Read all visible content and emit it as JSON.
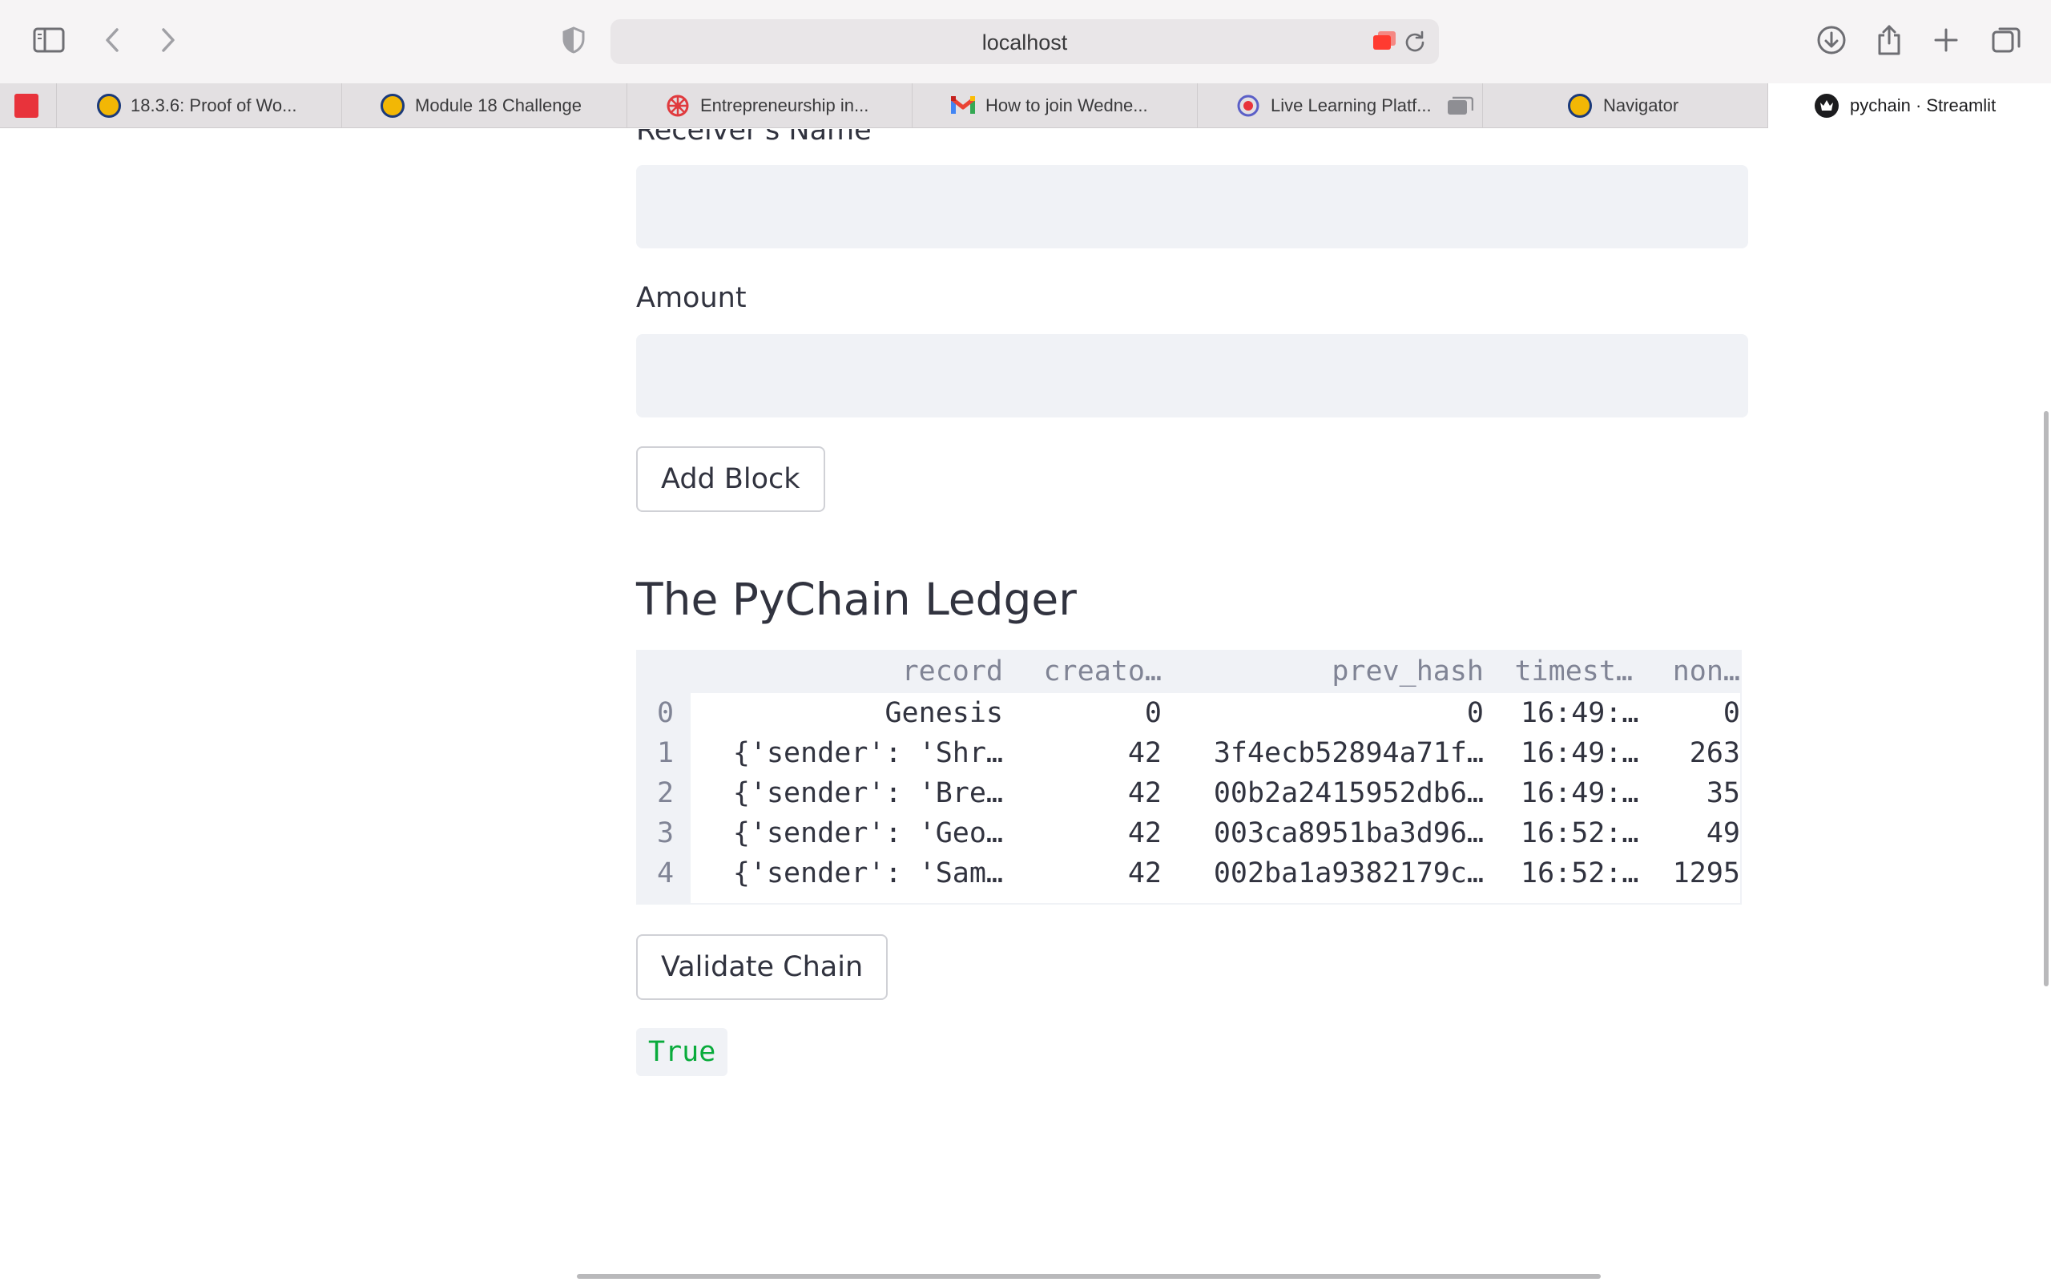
{
  "browser": {
    "url": "localhost",
    "tabs": [
      {
        "label": "",
        "favicon": "red-pinned-icon"
      },
      {
        "label": "18.3.6: Proof of Wo...",
        "favicon": "bootcamp-icon"
      },
      {
        "label": "Module 18 Challenge",
        "favicon": "bootcamp-icon"
      },
      {
        "label": "Entrepreneurship in...",
        "favicon": "red-wheel-icon"
      },
      {
        "label": "How to join Wedne...",
        "favicon": "gmail-icon"
      },
      {
        "label": "Live Learning Platf...",
        "favicon": "live-learning-icon"
      },
      {
        "label": "Navigator",
        "favicon": "bootcamp-icon"
      },
      {
        "label": "pychain · Streamlit",
        "favicon": "streamlit-icon"
      }
    ],
    "active_tab_index": 7
  },
  "form": {
    "receiver_label": "Receiver's Name",
    "receiver_value": "",
    "amount_label": "Amount",
    "amount_value": "",
    "add_block_label": "Add Block"
  },
  "ledger": {
    "heading": "The PyChain Ledger",
    "columns": [
      "record",
      "creato…",
      "prev_hash",
      "timest…",
      "non…"
    ],
    "rows": [
      {
        "index": "0",
        "record": "Genesis",
        "creator": "0",
        "prev_hash": "0",
        "timestamp": "16:49:…",
        "nonce": "0"
      },
      {
        "index": "1",
        "record": "{'sender': 'Shr…",
        "creator": "42",
        "prev_hash": "3f4ecb52894a71f…",
        "timestamp": "16:49:…",
        "nonce": "263"
      },
      {
        "index": "2",
        "record": "{'sender': 'Bre…",
        "creator": "42",
        "prev_hash": "00b2a2415952db6…",
        "timestamp": "16:49:…",
        "nonce": "35"
      },
      {
        "index": "3",
        "record": "{'sender': 'Geo…",
        "creator": "42",
        "prev_hash": "003ca8951ba3d96…",
        "timestamp": "16:52:…",
        "nonce": "49"
      },
      {
        "index": "4",
        "record": "{'sender': 'Sam…",
        "creator": "42",
        "prev_hash": "002ba1a9382179c…",
        "timestamp": "16:52:…",
        "nonce": "1295"
      }
    ],
    "validate_label": "Validate Chain",
    "validation_result": "True"
  },
  "colors": {
    "input_bg": "#f0f2f6",
    "text": "#31333f",
    "muted": "#808495",
    "success": "#09ab3b"
  }
}
